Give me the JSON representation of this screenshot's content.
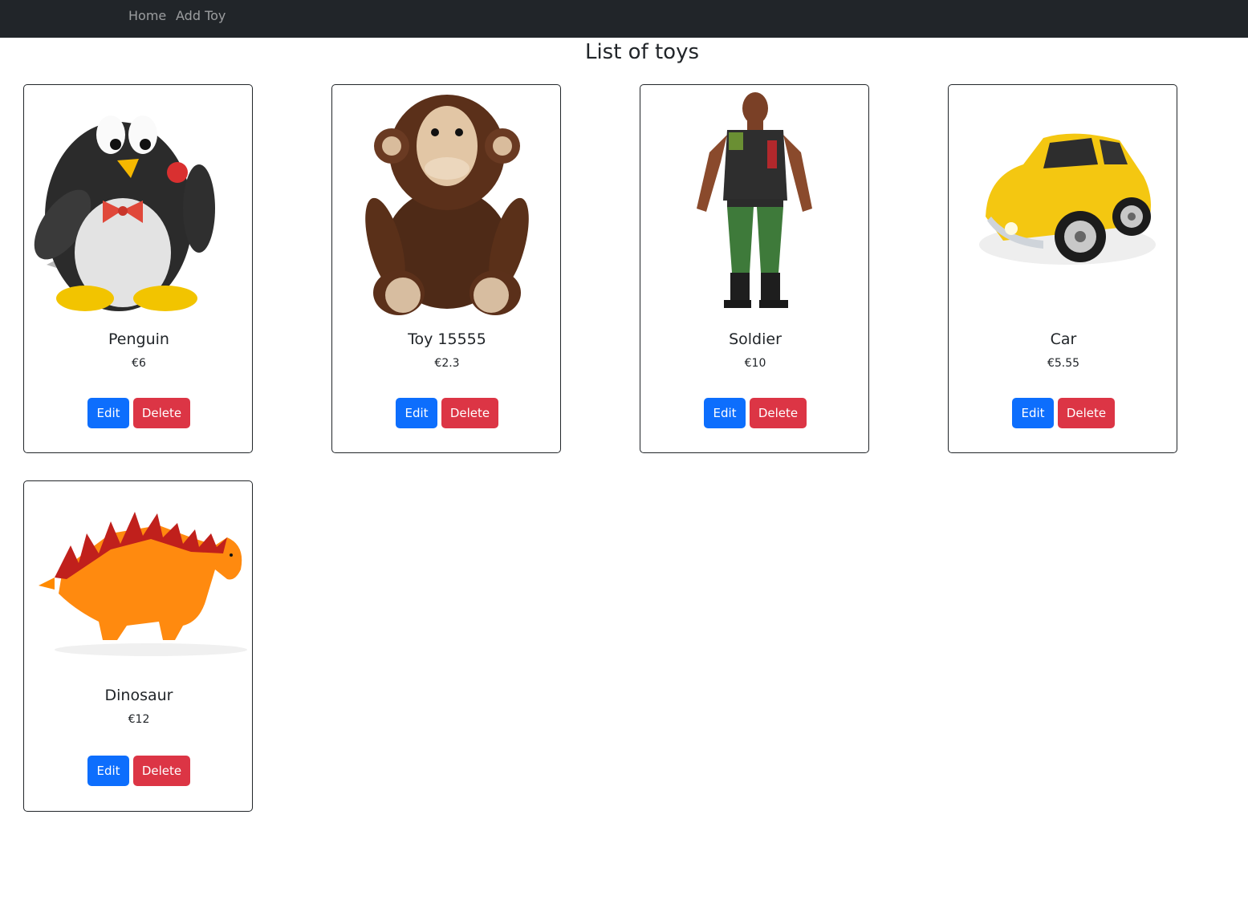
{
  "nav": {
    "home_label": "Home",
    "add_label": "Add Toy"
  },
  "page": {
    "title": "List of toys"
  },
  "buttons": {
    "edit_label": "Edit",
    "delete_label": "Delete"
  },
  "toys": [
    {
      "name": "Penguin",
      "price": "€6",
      "icon": "penguin-toy-image"
    },
    {
      "name": "Toy 15555",
      "price": "€2.3",
      "icon": "monkey-plush-image"
    },
    {
      "name": "Soldier",
      "price": "€10",
      "icon": "soldier-figure-image"
    },
    {
      "name": "Car",
      "price": "€5.55",
      "icon": "yellow-car-image"
    },
    {
      "name": "Dinosaur",
      "price": "€12",
      "icon": "dinosaur-toy-image"
    }
  ],
  "colors": {
    "navbar": "#212529",
    "edit": "#0d6efd",
    "delete": "#dc3545"
  }
}
